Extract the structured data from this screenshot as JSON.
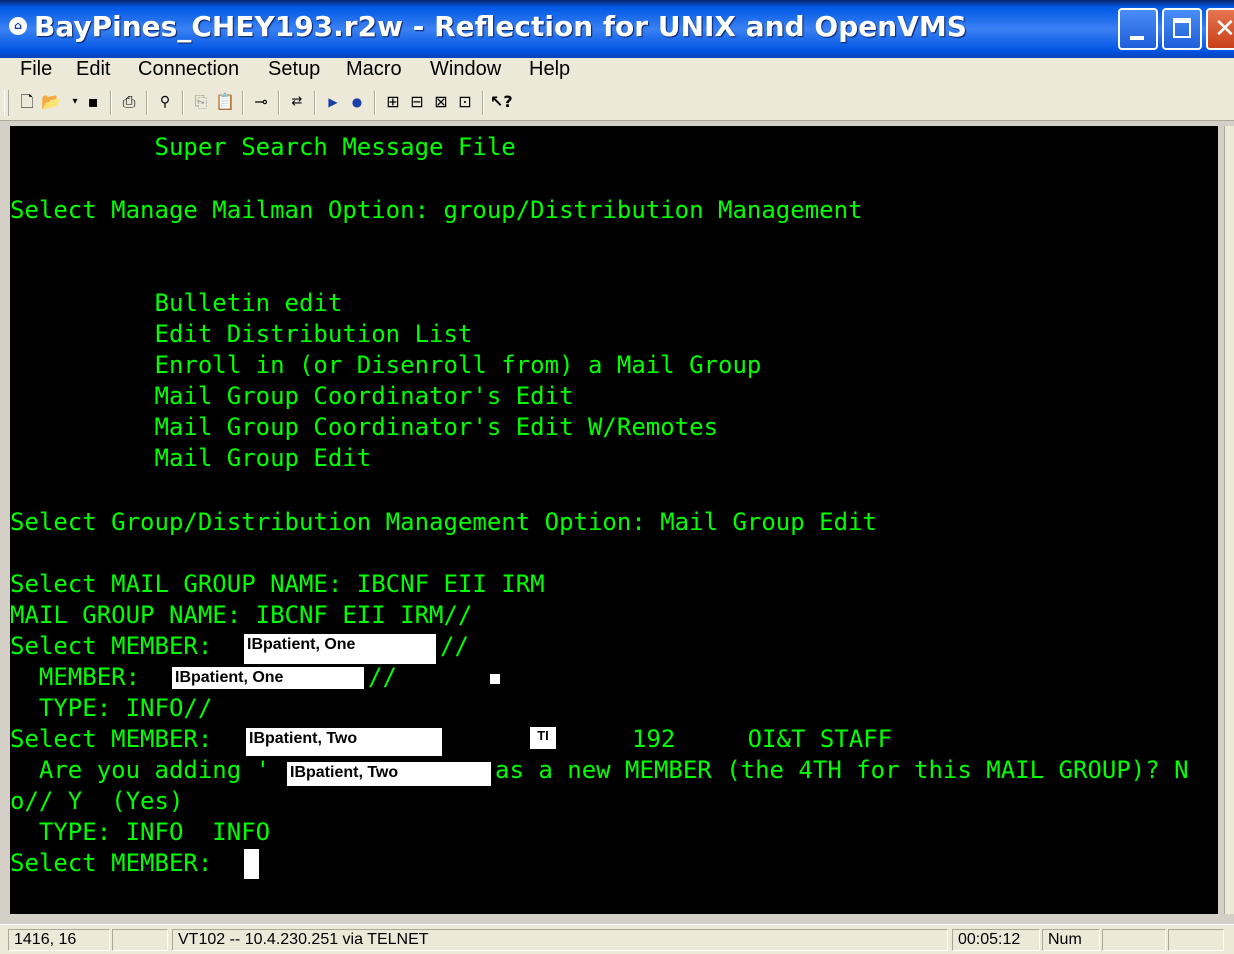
{
  "window": {
    "title": "BayPines_CHEY193.r2w - Reflection for UNIX and OpenVMS",
    "icon": "reflection-app-icon",
    "buttons": [
      "minimize",
      "maximize",
      "close"
    ]
  },
  "menu": {
    "items": [
      {
        "label": "File"
      },
      {
        "label": "Edit"
      },
      {
        "label": "Connection"
      },
      {
        "label": "Setup"
      },
      {
        "label": "Macro"
      },
      {
        "label": "Window"
      },
      {
        "label": "Help"
      }
    ]
  },
  "toolbar": {
    "icons": [
      "new-icon",
      "open-icon",
      "save-icon",
      "print-icon",
      "find-icon",
      "copy-icon",
      "paste-icon",
      "connect-icon",
      "disconnect-icon",
      "play-icon",
      "record-icon",
      "settings-icon",
      "transfer-icon",
      "keyboard-icon",
      "display-icon",
      "help-pointer-icon"
    ]
  },
  "terminal": {
    "colors": {
      "background": "#000000",
      "text": "#00ff00",
      "highlight": "#ffffff"
    },
    "lines": [
      "          Super Search Message File",
      "",
      "Select Manage Mailman Option: group/Distribution Management",
      "",
      "",
      "          Bulletin edit",
      "          Edit Distribution List",
      "          Enroll in (or Disenroll from) a Mail Group",
      "          Mail Group Coordinator's Edit",
      "          Mail Group Coordinator's Edit W/Remotes",
      "          Mail Group Edit",
      "",
      "Select Group/Distribution Management Option: Mail Group Edit",
      "",
      "Select MAIL GROUP NAME: IBCNF EII IRM",
      "MAIL GROUP NAME: IBCNF EII IRM//",
      "Select MEMBER: ",
      "  MEMBER: ",
      "  TYPE: INFO//",
      "Select MEMBER: ",
      "  Are you adding '",
      "o// Y  (Yes)",
      "  TYPE: INFO  INFO",
      "Select MEMBER: "
    ],
    "segments": {
      "slash1": "//",
      "slash2": "//",
      "staff_info": "192     OI&T STAFF",
      "adding_rest": "as a new MEMBER (the 4TH for this MAIL GROUP)? N"
    },
    "redactions": {
      "r1": "IBpatient, One",
      "r2": "IBpatient, One",
      "r3": "IBpatient, Two",
      "r4": "IBpatient, Two",
      "tiny": "TI"
    }
  },
  "status": {
    "position": "1416, 16",
    "connection": "VT102 -- 10.4.230.251 via TELNET",
    "time": "00:05:12",
    "num": "Num"
  }
}
